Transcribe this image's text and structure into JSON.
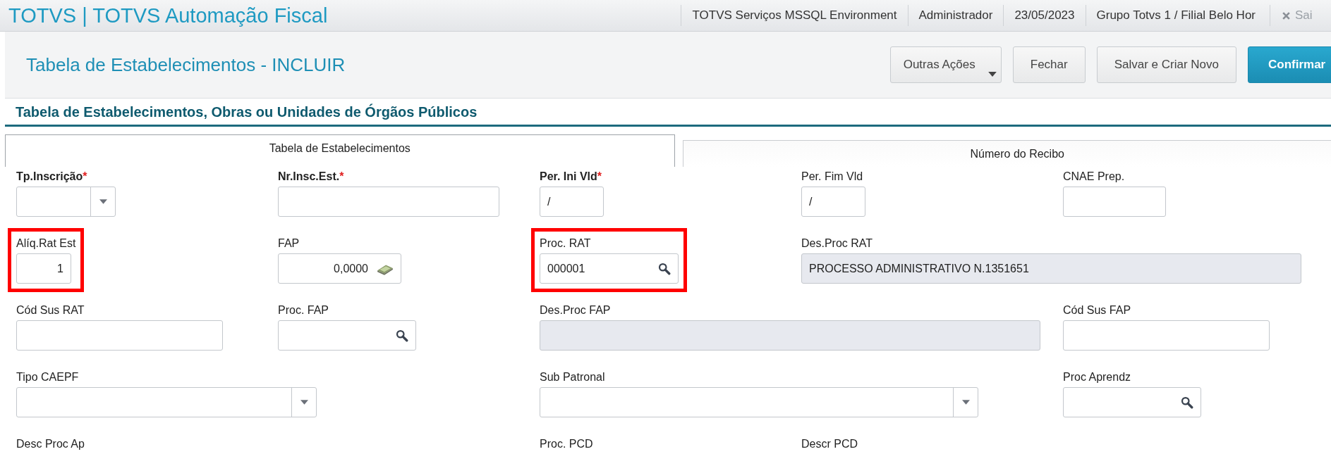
{
  "app_bar": {
    "title": "TOTVS | TOTVS Automação Fiscal",
    "items": [
      "TOTVS Serviços MSSQL Environment",
      "Administrador",
      "23/05/2023",
      "Grupo Totvs 1 / Filial Belo Hor"
    ],
    "exit_label": "Sai"
  },
  "page": {
    "title": "Tabela de Estabelecimentos - INCLUIR",
    "buttons": [
      {
        "label": "Outras Ações",
        "kind": "menu"
      },
      {
        "label": "Fechar",
        "kind": "plain"
      },
      {
        "label": "Salvar e Criar Novo",
        "kind": "plain"
      },
      {
        "label": "Confirmar",
        "kind": "primary"
      }
    ]
  },
  "section_title": "Tabela de Estabelecimentos, Obras ou Unidades de Órgãos Públicos",
  "tabs": [
    {
      "label": "Tabela de Estabelecimentos",
      "selected": true
    },
    {
      "label": "Número do Recibo",
      "selected": false
    }
  ],
  "rows": [
    [
      {
        "label": "Tp.Inscrição",
        "required_mark": "*",
        "kind": "select",
        "highlighted": false
      },
      {
        "label": "Nr.Insc.Est.",
        "required_mark": "*",
        "kind": "text",
        "highlighted": false
      },
      {
        "label": "Per. Ini Vld",
        "required_mark": "*",
        "kind": "text",
        "value": "/",
        "highlighted": false
      },
      {
        "label": "Per. Fim Vld",
        "kind": "text",
        "value": "/",
        "highlighted": false
      },
      {
        "label": "CNAE Prep.",
        "kind": "text",
        "highlighted": false
      }
    ],
    [
      {
        "label": "Alíq.Rat Est",
        "kind": "number",
        "value": "1",
        "highlighted": true
      },
      {
        "label": "FAP",
        "kind": "money",
        "value": "0,0000",
        "highlighted": false
      },
      {
        "label": "Proc. RAT",
        "kind": "lookup",
        "value": "000001",
        "highlighted": true
      },
      {
        "label": "Des.Proc RAT",
        "kind": "readonly",
        "value": "PROCESSO ADMINISTRATIVO N.1351651",
        "highlighted": false
      }
    ],
    [
      {
        "label": "Cód Sus RAT",
        "kind": "text",
        "highlighted": false
      },
      {
        "label": "Proc. FAP",
        "kind": "lookup",
        "highlighted": false
      },
      {
        "label": "Des.Proc FAP",
        "kind": "readonly",
        "highlighted": false
      },
      {
        "label": "Cód Sus FAP",
        "kind": "text",
        "highlighted": false
      }
    ],
    [
      {
        "label": "Tipo CAEPF",
        "kind": "select",
        "highlighted": false
      },
      {
        "label": "Sub Patronal",
        "kind": "select",
        "highlighted": false
      },
      {
        "label": "Proc Aprendz",
        "kind": "lookup",
        "highlighted": false
      }
    ],
    [
      {
        "label": "Desc Proc Ap",
        "kind": "label",
        "highlighted": false
      },
      {
        "label": "Proc. PCD",
        "kind": "label",
        "highlighted": false
      },
      {
        "label": "Descr PCD",
        "kind": "label",
        "highlighted": false
      }
    ]
  ]
}
